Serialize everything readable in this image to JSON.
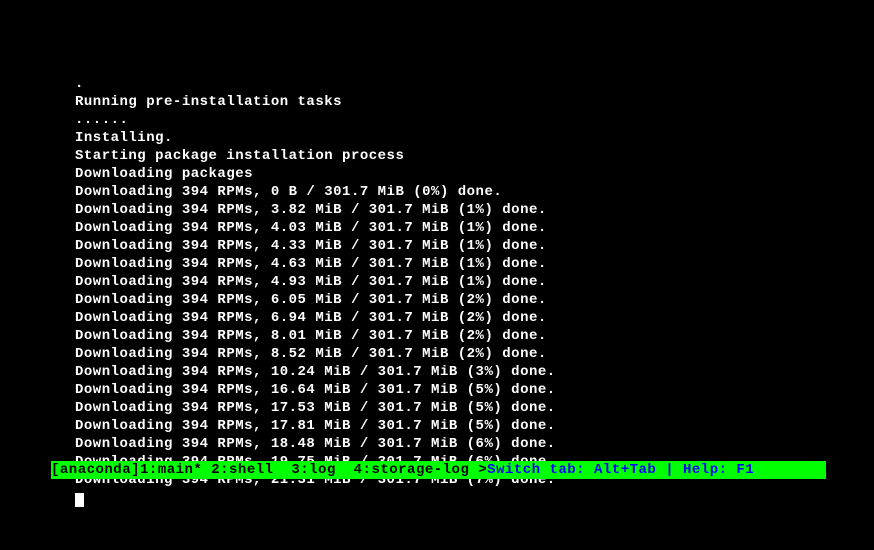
{
  "terminal": {
    "lines": [
      ".",
      "Running pre-installation tasks",
      "......",
      "Installing.",
      "Starting package installation process",
      "Downloading packages",
      "Downloading 394 RPMs, 0 B / 301.7 MiB (0%) done.",
      "Downloading 394 RPMs, 3.82 MiB / 301.7 MiB (1%) done.",
      "Downloading 394 RPMs, 4.03 MiB / 301.7 MiB (1%) done.",
      "Downloading 394 RPMs, 4.33 MiB / 301.7 MiB (1%) done.",
      "Downloading 394 RPMs, 4.63 MiB / 301.7 MiB (1%) done.",
      "Downloading 394 RPMs, 4.93 MiB / 301.7 MiB (1%) done.",
      "Downloading 394 RPMs, 6.05 MiB / 301.7 MiB (2%) done.",
      "Downloading 394 RPMs, 6.94 MiB / 301.7 MiB (2%) done.",
      "Downloading 394 RPMs, 8.01 MiB / 301.7 MiB (2%) done.",
      "Downloading 394 RPMs, 8.52 MiB / 301.7 MiB (2%) done.",
      "Downloading 394 RPMs, 10.24 MiB / 301.7 MiB (3%) done.",
      "Downloading 394 RPMs, 16.64 MiB / 301.7 MiB (5%) done.",
      "Downloading 394 RPMs, 17.53 MiB / 301.7 MiB (5%) done.",
      "Downloading 394 RPMs, 17.81 MiB / 301.7 MiB (5%) done.",
      "Downloading 394 RPMs, 18.48 MiB / 301.7 MiB (6%) done.",
      "Downloading 394 RPMs, 19.75 MiB / 301.7 MiB (6%) done.",
      "Downloading 394 RPMs, 21.31 MiB / 301.7 MiB (7%) done."
    ]
  },
  "statusbar": {
    "tabs": "[anaconda]1:main* 2:shell  3:log  4:storage-log >",
    "help": "Switch tab: Alt+Tab | Help: F1"
  }
}
